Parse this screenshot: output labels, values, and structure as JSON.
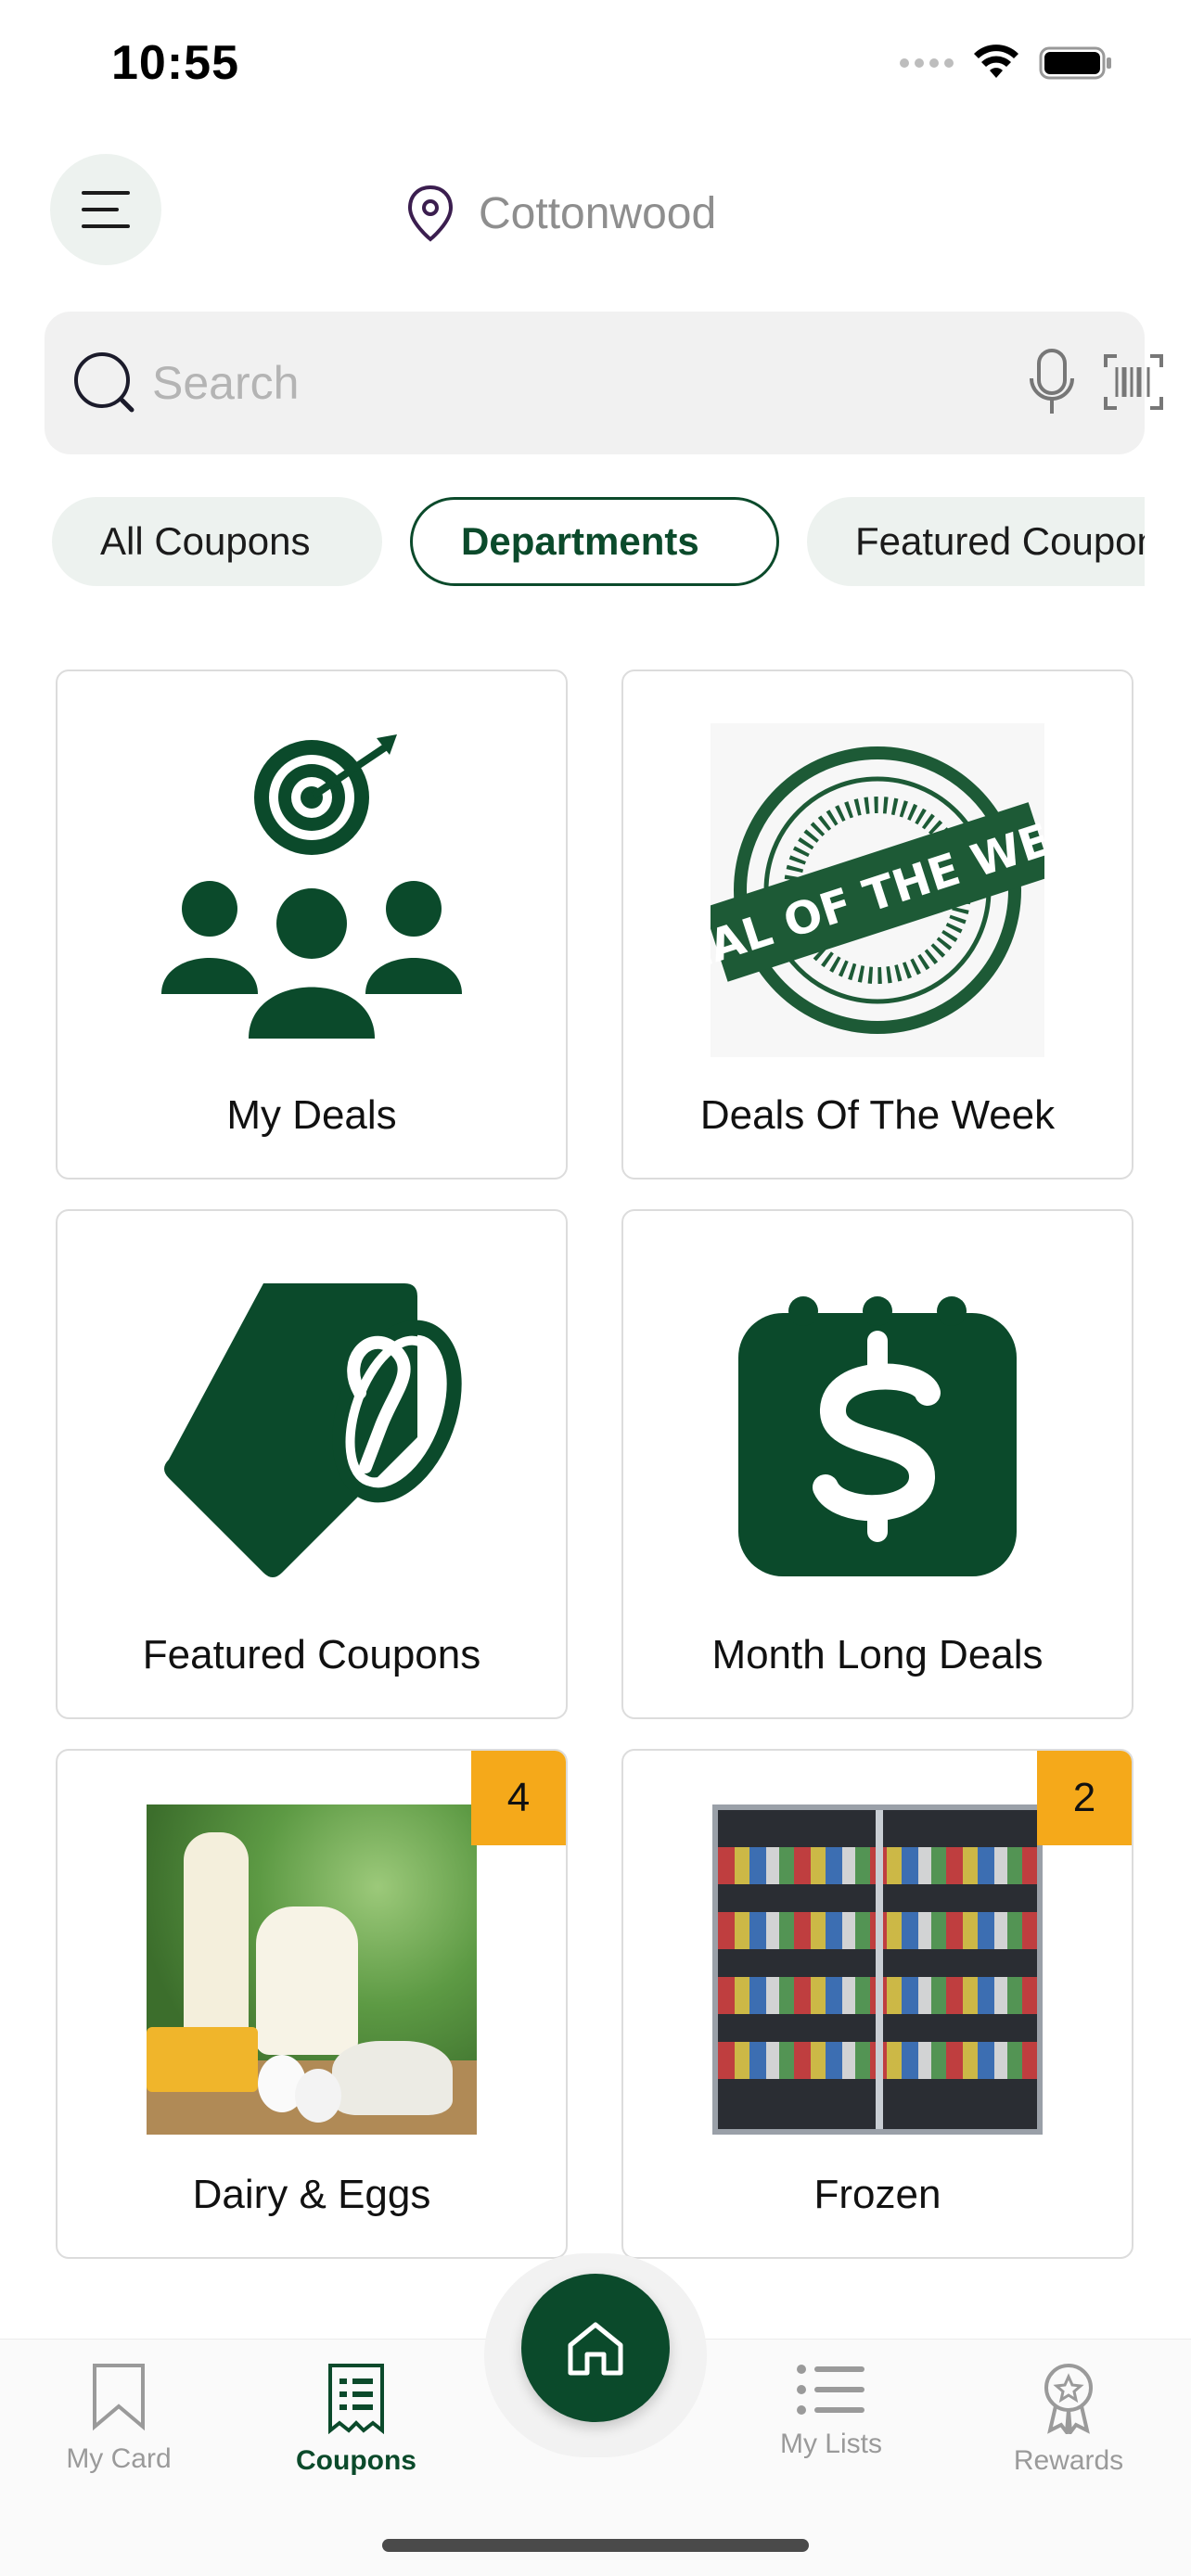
{
  "status_bar": {
    "time": "10:55"
  },
  "header": {
    "location": "Cottonwood"
  },
  "search": {
    "placeholder": "Search"
  },
  "chips": [
    {
      "label": "All Coupons",
      "active": false
    },
    {
      "label": "Departments",
      "active": true
    },
    {
      "label": "Featured Coupons",
      "active": false
    }
  ],
  "cards": [
    {
      "label": "My Deals",
      "icon": "target-people-icon"
    },
    {
      "label": "Deals Of The Week",
      "icon": "deal-of-the-week-stamp",
      "stamp_text": "DEAL OF THE WEEK"
    },
    {
      "label": "Featured Coupons",
      "icon": "tag-icon"
    },
    {
      "label": "Month Long Deals",
      "icon": "calendar-dollar-icon"
    },
    {
      "label": "Dairy & Eggs",
      "badge": "4"
    },
    {
      "label": "Frozen",
      "badge": "2"
    }
  ],
  "tabbar": {
    "my_card": "My Card",
    "coupons": "Coupons",
    "my_lists": "My Lists",
    "rewards": "Rewards"
  },
  "colors": {
    "brand_green": "#0b4a2b",
    "badge_orange": "#f5a91a"
  }
}
